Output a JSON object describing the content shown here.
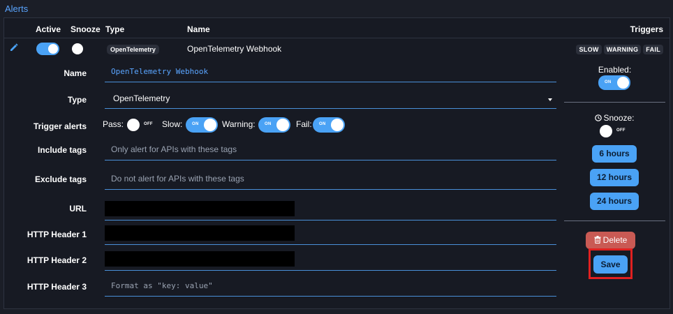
{
  "section_title": "Alerts",
  "columns": {
    "active": "Active",
    "snooze": "Snooze",
    "type": "Type",
    "name": "Name",
    "triggers": "Triggers"
  },
  "row": {
    "active": true,
    "snoozed": false,
    "type": "OpenTelemetry",
    "name": "OpenTelemetry Webhook",
    "triggers": [
      "SLOW",
      "WARNING",
      "FAIL"
    ]
  },
  "toggle_text": {
    "on": "ON",
    "off": "OFF"
  },
  "form": {
    "name_label": "Name",
    "name_value": "OpenTelemetry Webhook",
    "type_label": "Type",
    "type_value": "OpenTelemetry",
    "trigger_label": "Trigger alerts",
    "triggers": [
      {
        "label": "Pass:",
        "on": false
      },
      {
        "label": "Slow:",
        "on": true
      },
      {
        "label": "Warning:",
        "on": true
      },
      {
        "label": "Fail:",
        "on": true
      }
    ],
    "include_tags_label": "Include tags",
    "include_tags_placeholder": "Only alert for APIs with these tags",
    "exclude_tags_label": "Exclude tags",
    "exclude_tags_placeholder": "Do not alert for APIs with these tags",
    "url_label": "URL",
    "header1_label": "HTTP Header 1",
    "header2_label": "HTTP Header 2",
    "header3_label": "HTTP Header 3",
    "header3_placeholder": "Format as \"key: value\""
  },
  "side": {
    "enabled_label": "Enabled:",
    "enabled": true,
    "snooze_label": "Snooze:",
    "snoozed": false,
    "snooze_options": [
      "6 hours",
      "12 hours",
      "24 hours"
    ],
    "delete_label": "Delete",
    "save_label": "Save"
  },
  "colors": {
    "accent": "#4aa2f5",
    "danger": "#c95a54",
    "highlight": "#e02020",
    "background": "#171a23"
  }
}
